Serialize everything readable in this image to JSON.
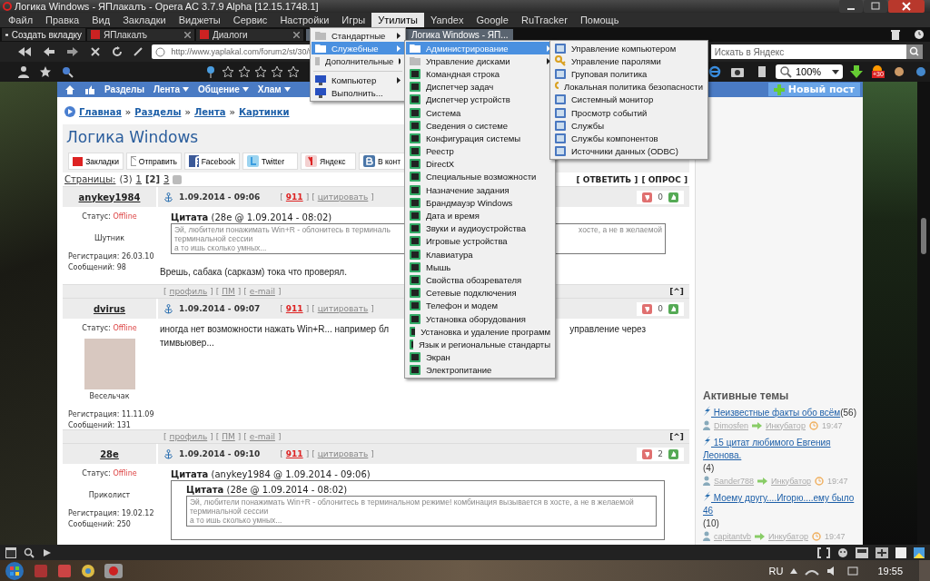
{
  "window": {
    "title": "Логика Windows - ЯПлакалъ - Opera AC 3.7.9 Alpha [12.15.1748.1]"
  },
  "menu_bar": [
    {
      "label": "Файл",
      "selected": false
    },
    {
      "label": "Правка",
      "selected": false
    },
    {
      "label": "Вид",
      "selected": false
    },
    {
      "label": "Закладки",
      "selected": false
    },
    {
      "label": "Виджеты",
      "selected": false
    },
    {
      "label": "Сервис",
      "selected": false
    },
    {
      "label": "Настройки",
      "selected": false
    },
    {
      "label": "Игры",
      "selected": false
    },
    {
      "label": "Утилиты",
      "selected": true
    },
    {
      "label": "Yandex",
      "selected": false
    },
    {
      "label": "Google",
      "selected": false
    },
    {
      "label": "RuTracker",
      "selected": false
    },
    {
      "label": "Помощь",
      "selected": false
    }
  ],
  "new_tab_button": "Создать вкладку",
  "tabs": [
    {
      "label": "ЯПлакалъ",
      "selected": false
    },
    {
      "label": "Диалоги",
      "selected": false
    },
    {
      "label": "Логика Windows - ЯП...",
      "selected": true
    }
  ],
  "address_bar": {
    "url": "http://www.yaplakal.com/forum2/st/30/t"
  },
  "search": {
    "placeholder": "Искать в Яндекс"
  },
  "rating": {
    "stars": 0
  },
  "weather_badge": "+30",
  "zoom": "100%",
  "site_nav": {
    "items": [
      {
        "label": "Разделы",
        "has_menu": false
      },
      {
        "label": "Лента",
        "has_menu": true
      },
      {
        "label": "Общение",
        "has_menu": true
      },
      {
        "label": "Хлам",
        "has_menu": true
      }
    ],
    "new_post": "Новый пост"
  },
  "breadcrumb": {
    "items": [
      "Главная",
      "Разделы",
      "Лента",
      "Картинки"
    ],
    "separator": "»"
  },
  "topic_title": "Логика Windows",
  "share_buttons": [
    {
      "label": "Закладки",
      "kind": "yap"
    },
    {
      "label": "Отправить",
      "kind": "mail"
    },
    {
      "label": "Facebook",
      "kind": "facebook"
    },
    {
      "label": "Twitter",
      "kind": "twitter"
    },
    {
      "label": "Яндекс",
      "kind": "yandex"
    },
    {
      "label": "В конт",
      "kind": "vk"
    }
  ],
  "pages": {
    "label": "Страницы:",
    "count": "(3)",
    "items": [
      {
        "label": "1",
        "selected": false
      },
      {
        "label": "[2]",
        "selected": true
      },
      {
        "label": "3",
        "selected": false
      }
    ]
  },
  "topic_actions": [
    "[ ОТВЕТИТЬ ]",
    "[ ОПРОС ]"
  ],
  "posts": [
    {
      "author": "anykey1984",
      "date": "1.09.2014 - 09:06",
      "actions": [
        [
          "[",
          "911",
          "]"
        ],
        [
          "[",
          "цитировать",
          "]"
        ]
      ],
      "votes": "0",
      "status_label": "Статус:",
      "status": "Offline",
      "has_avatar": false,
      "rank": "Шутник",
      "registered": "Регистрация: 26.03.10",
      "messages": "Сообщений: 98",
      "quote": {
        "title": "**Цитата** (28e @ 1.09.2014 - 08:02)",
        "lines": [
          [
            "Эй, любители понажимать Win+R - облонитесь в терминаль",
            "хосте, а не в желаемой"
          ],
          [
            "терминальной сессии"
          ],
          [
            "а то ишь сколько умных..."
          ]
        ]
      },
      "body": [
        [
          "Врешь, сабака (сарказм) тока что проверял."
        ]
      ],
      "footer": [
        [
          "[",
          "профиль",
          "]"
        ],
        [
          "[",
          "ПМ",
          "]"
        ],
        [
          "[",
          "e-mail",
          "]"
        ]
      ],
      "top_link": "[^]"
    },
    {
      "author": "dvirus",
      "date": "1.09.2014 - 09:07",
      "actions": [
        [
          "[",
          "911",
          "]"
        ],
        [
          "[",
          "цитировать",
          "]"
        ]
      ],
      "votes": "0",
      "status_label": "Статус:",
      "status": "Offline",
      "has_avatar": true,
      "rank": "Весельчак",
      "registered": "Регистрация: 11.11.09",
      "messages": "Сообщений: 131",
      "body": [
        [
          "иногда нет возможности нажать Win+R... например бл",
          "управление через"
        ],
        [
          "тимвьювер..."
        ]
      ],
      "footer": [
        [
          "[",
          "профиль",
          "]"
        ],
        [
          "[",
          "ПМ",
          "]"
        ],
        [
          "[",
          "e-mail",
          "]"
        ]
      ],
      "top_link": "[^]"
    },
    {
      "author": "28e",
      "date": "1.09.2014 - 09:10",
      "actions": [
        [
          "[",
          "911",
          "]"
        ],
        [
          "[",
          "цитировать",
          "]"
        ]
      ],
      "votes": "2",
      "status_label": "Статус:",
      "status": "Offline",
      "has_avatar": false,
      "rank": "Приколист",
      "registered": "Регистрация: 19.02.12",
      "messages": "Сообщений: 250",
      "quote": {
        "title": "**Цитата** (anykey1984 @ 1.09.2014 - 09:06)",
        "nested": {
          "title": "**Цитата** (28e @ 1.09.2014 - 08:02)",
          "lines": [
            [
              "Эй, любители понажимать Win+R - облонитесь в терминальном режиме! комбинация вызывается в хосте, а не в желаемой"
            ],
            [
              "терминальной сессии"
            ],
            [
              "а то ишь сколько умных..."
            ]
          ]
        }
      }
    }
  ],
  "active_topics": {
    "title": "Активные темы",
    "items": [
      {
        "title": "Неизвестные факты обо всём",
        "count": "(56)",
        "author": "Dimosfen",
        "section": "Инкубатор",
        "time": "19:47"
      },
      {
        "title": "15 цитат любимого Евгения Леонова.",
        "count": "(4)",
        "author": "Sander788",
        "section": "Инкубатор",
        "time": "19:47"
      },
      {
        "title": "Моему другу....Игорю....ему было 46",
        "count": "(10)",
        "author": "capitantvb",
        "section": "Инкубатор",
        "time": "19:47"
      }
    ]
  },
  "utilities_menu": [
    {
      "label": "Стандартные",
      "kind": "folder",
      "submenu": true,
      "selected": false
    },
    {
      "label": "Служебные",
      "kind": "folder",
      "submenu": true,
      "selected": true
    },
    {
      "label": "Дополнительные",
      "kind": "folder",
      "submenu": true,
      "selected": false
    },
    {
      "kind": "separator"
    },
    {
      "label": "Компьютер",
      "kind": "app",
      "submenu": true,
      "selected": false
    },
    {
      "label": "Выполнить...",
      "kind": "app",
      "submenu": false,
      "selected": false
    }
  ],
  "system_tools_menu": [
    {
      "label": "Администрирование",
      "kind": "folder",
      "submenu": true,
      "selected": true
    },
    {
      "label": "Управление дисками",
      "kind": "folder",
      "submenu": true,
      "selected": false
    },
    {
      "label": "Командная строка",
      "kind": "app",
      "submenu": false,
      "selected": false
    },
    {
      "label": "Диспетчер задач",
      "kind": "app",
      "submenu": false,
      "selected": false
    },
    {
      "label": "Диспетчер устройств",
      "kind": "app",
      "submenu": false,
      "selected": false
    },
    {
      "label": "Система",
      "kind": "app",
      "submenu": false,
      "selected": false
    },
    {
      "label": "Сведения о системе",
      "kind": "app",
      "submenu": false,
      "selected": false
    },
    {
      "label": "Конфигурация системы",
      "kind": "app",
      "submenu": false,
      "selected": false
    },
    {
      "label": "Реестр",
      "kind": "app",
      "submenu": false,
      "selected": false
    },
    {
      "label": "DirectX",
      "kind": "app",
      "submenu": false,
      "selected": false
    },
    {
      "label": "Специальные возможности",
      "kind": "app",
      "submenu": false,
      "selected": false
    },
    {
      "label": "Назначение задания",
      "kind": "app",
      "submenu": false,
      "selected": false
    },
    {
      "label": "Брандмауэр Windows",
      "kind": "app",
      "submenu": false,
      "selected": false
    },
    {
      "label": "Дата и время",
      "kind": "app",
      "submenu": false,
      "selected": false
    },
    {
      "label": "Звуки и аудиоустройства",
      "kind": "app",
      "submenu": false,
      "selected": false
    },
    {
      "label": "Игровые устройства",
      "kind": "app",
      "submenu": false,
      "selected": false
    },
    {
      "label": "Клавиатура",
      "kind": "app",
      "submenu": false,
      "selected": false
    },
    {
      "label": "Мышь",
      "kind": "app",
      "submenu": false,
      "selected": false
    },
    {
      "label": "Свойства обозревателя",
      "kind": "app",
      "submenu": false,
      "selected": false
    },
    {
      "label": "Сетевые подключения",
      "kind": "app",
      "submenu": false,
      "selected": false
    },
    {
      "label": "Телефон и модем",
      "kind": "app",
      "submenu": false,
      "selected": false
    },
    {
      "label": "Установка оборудования",
      "kind": "app",
      "submenu": false,
      "selected": false
    },
    {
      "label": "Установка и удаление программ",
      "kind": "app",
      "submenu": false,
      "selected": false
    },
    {
      "label": "Язык и региональные стандарты",
      "kind": "app",
      "submenu": false,
      "selected": false
    },
    {
      "label": "Экран",
      "kind": "app",
      "submenu": false,
      "selected": false
    },
    {
      "label": "Электропитание",
      "kind": "app",
      "submenu": false,
      "selected": false
    }
  ],
  "admin_menu": [
    {
      "label": "Управление компьютером",
      "kind": "app"
    },
    {
      "label": "Управление паролями",
      "kind": "key"
    },
    {
      "label": "Груповая политика",
      "kind": "app"
    },
    {
      "label": "Локальная политика безопасности",
      "kind": "key"
    },
    {
      "label": "Системный монитор",
      "kind": "app"
    },
    {
      "label": "Просмотр событий",
      "kind": "app"
    },
    {
      "label": "Службы",
      "kind": "app"
    },
    {
      "label": "Службы компонентов",
      "kind": "app"
    },
    {
      "label": "Источники данных (ODBC)",
      "kind": "app"
    }
  ],
  "taskbar": {
    "language": "RU",
    "clock": "19:55"
  }
}
